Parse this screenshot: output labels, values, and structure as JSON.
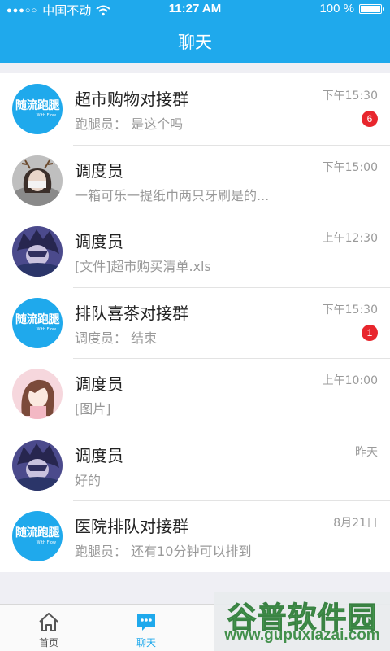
{
  "status_bar": {
    "carrier": "中国不动",
    "time": "11:27 AM",
    "battery": "100 %"
  },
  "navbar": {
    "title": "聊天"
  },
  "avatar_logo": {
    "text": "随流跑腿",
    "sub": "With Flow"
  },
  "chats": [
    {
      "name": "超市购物对接群",
      "preview": "跑腿员： 是这个吗",
      "time": "下午15:30",
      "badge": "6",
      "avatar": "logo"
    },
    {
      "name": "调度员",
      "preview": "一箱可乐一提纸巾两只牙刷是的...",
      "time": "下午15:00",
      "badge": "",
      "avatar": "girl-antlers"
    },
    {
      "name": "调度员",
      "preview": "[文件]超市购买清单.xls",
      "time": "上午12:30",
      "badge": "",
      "avatar": "anime-boy"
    },
    {
      "name": "排队喜茶对接群",
      "preview": "调度员： 结束",
      "time": "下午15:30",
      "badge": "1",
      "avatar": "logo"
    },
    {
      "name": "调度员",
      "preview": "[图片]",
      "time": "上午10:00",
      "badge": "",
      "avatar": "anime-girl"
    },
    {
      "name": "调度员",
      "preview": "好的",
      "time": "昨天",
      "badge": "",
      "avatar": "anime-boy"
    },
    {
      "name": "医院排队对接群",
      "preview": "跑腿员： 还有10分钟可以排到",
      "time": "8月21日",
      "badge": "",
      "avatar": "logo"
    }
  ],
  "tabs": [
    {
      "label": "首页",
      "active": false
    },
    {
      "label": "聊天",
      "active": true
    }
  ],
  "watermark": {
    "title": "谷普软件园",
    "url": "www.gupuxiazai.com"
  },
  "colors": {
    "brand": "#1fa9ec",
    "badge": "#e8262d"
  }
}
